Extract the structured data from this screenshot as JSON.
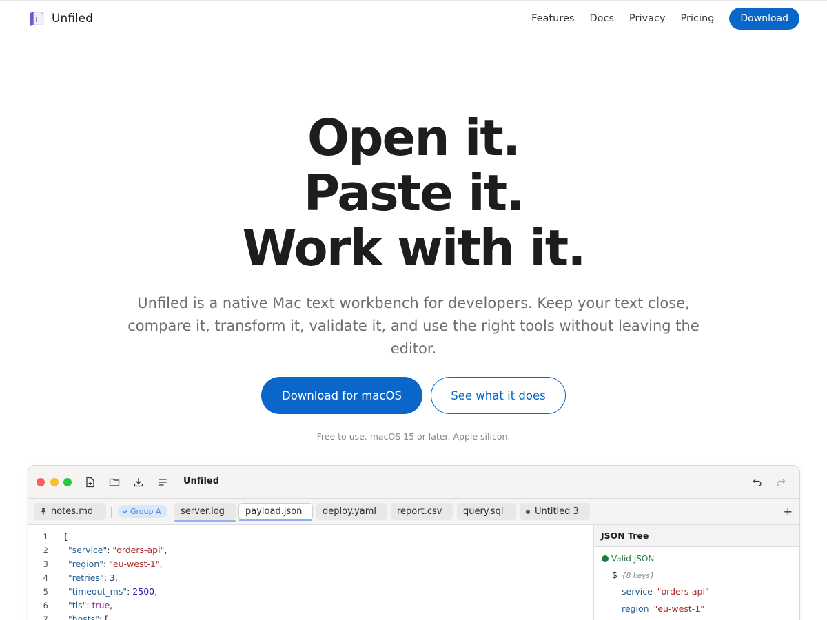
{
  "nav": {
    "brand": "Unfiled",
    "links": [
      "Features",
      "Docs",
      "Privacy",
      "Pricing"
    ],
    "download": "Download"
  },
  "hero": {
    "line1": "Open it.",
    "line2": "Paste it.",
    "line3": "Work with it.",
    "subtitle": "Unfiled is a native Mac text workbench for developers. Keep your text close, compare it, transform it, validate it, and use the right tools without leaving the editor.",
    "primary_cta": "Download for macOS",
    "secondary_cta": "See what it does",
    "fine_print": "Free to use. macOS 15 or later. Apple silicon."
  },
  "app": {
    "title": "Unfiled",
    "toolbar_icons": [
      "new-file-icon",
      "folder-icon",
      "download-icon",
      "list-icon",
      "undo-icon",
      "redo-icon"
    ],
    "pinned_tab": "notes.md",
    "group_label": "Group A",
    "tabs": [
      {
        "label": "server.log"
      },
      {
        "label": "payload.json"
      },
      {
        "label": "deploy.yaml"
      },
      {
        "label": "report.csv"
      },
      {
        "label": "query.sql"
      },
      {
        "label": "Untitled 3"
      }
    ],
    "active_tab": "payload.json",
    "add_tab": "+",
    "line_numbers": [
      "1",
      "2",
      "3",
      "4",
      "5",
      "6",
      "7"
    ],
    "code": {
      "l1": "{",
      "l2_key": "\"service\"",
      "l2_val": "\"orders-api\"",
      "l3_key": "\"region\"",
      "l3_val": "\"eu-west-1\"",
      "l4_key": "\"retries\"",
      "l4_val": "3",
      "l5_key": "\"timeout_ms\"",
      "l5_val": "2500",
      "l6_key": "\"tls\"",
      "l6_val": "true",
      "l7_key": "\"hosts\"",
      "l7_val": "["
    },
    "side_panel": {
      "title": "JSON Tree",
      "status": "Valid JSON",
      "root": "$",
      "root_meta": "{8 keys}",
      "rows": [
        {
          "key": "service",
          "value": "\"orders-api\""
        },
        {
          "key": "region",
          "value": "\"eu-west-1\""
        }
      ]
    }
  },
  "colors": {
    "accent": "#0a66c8",
    "valid": "#1e7a3c"
  }
}
